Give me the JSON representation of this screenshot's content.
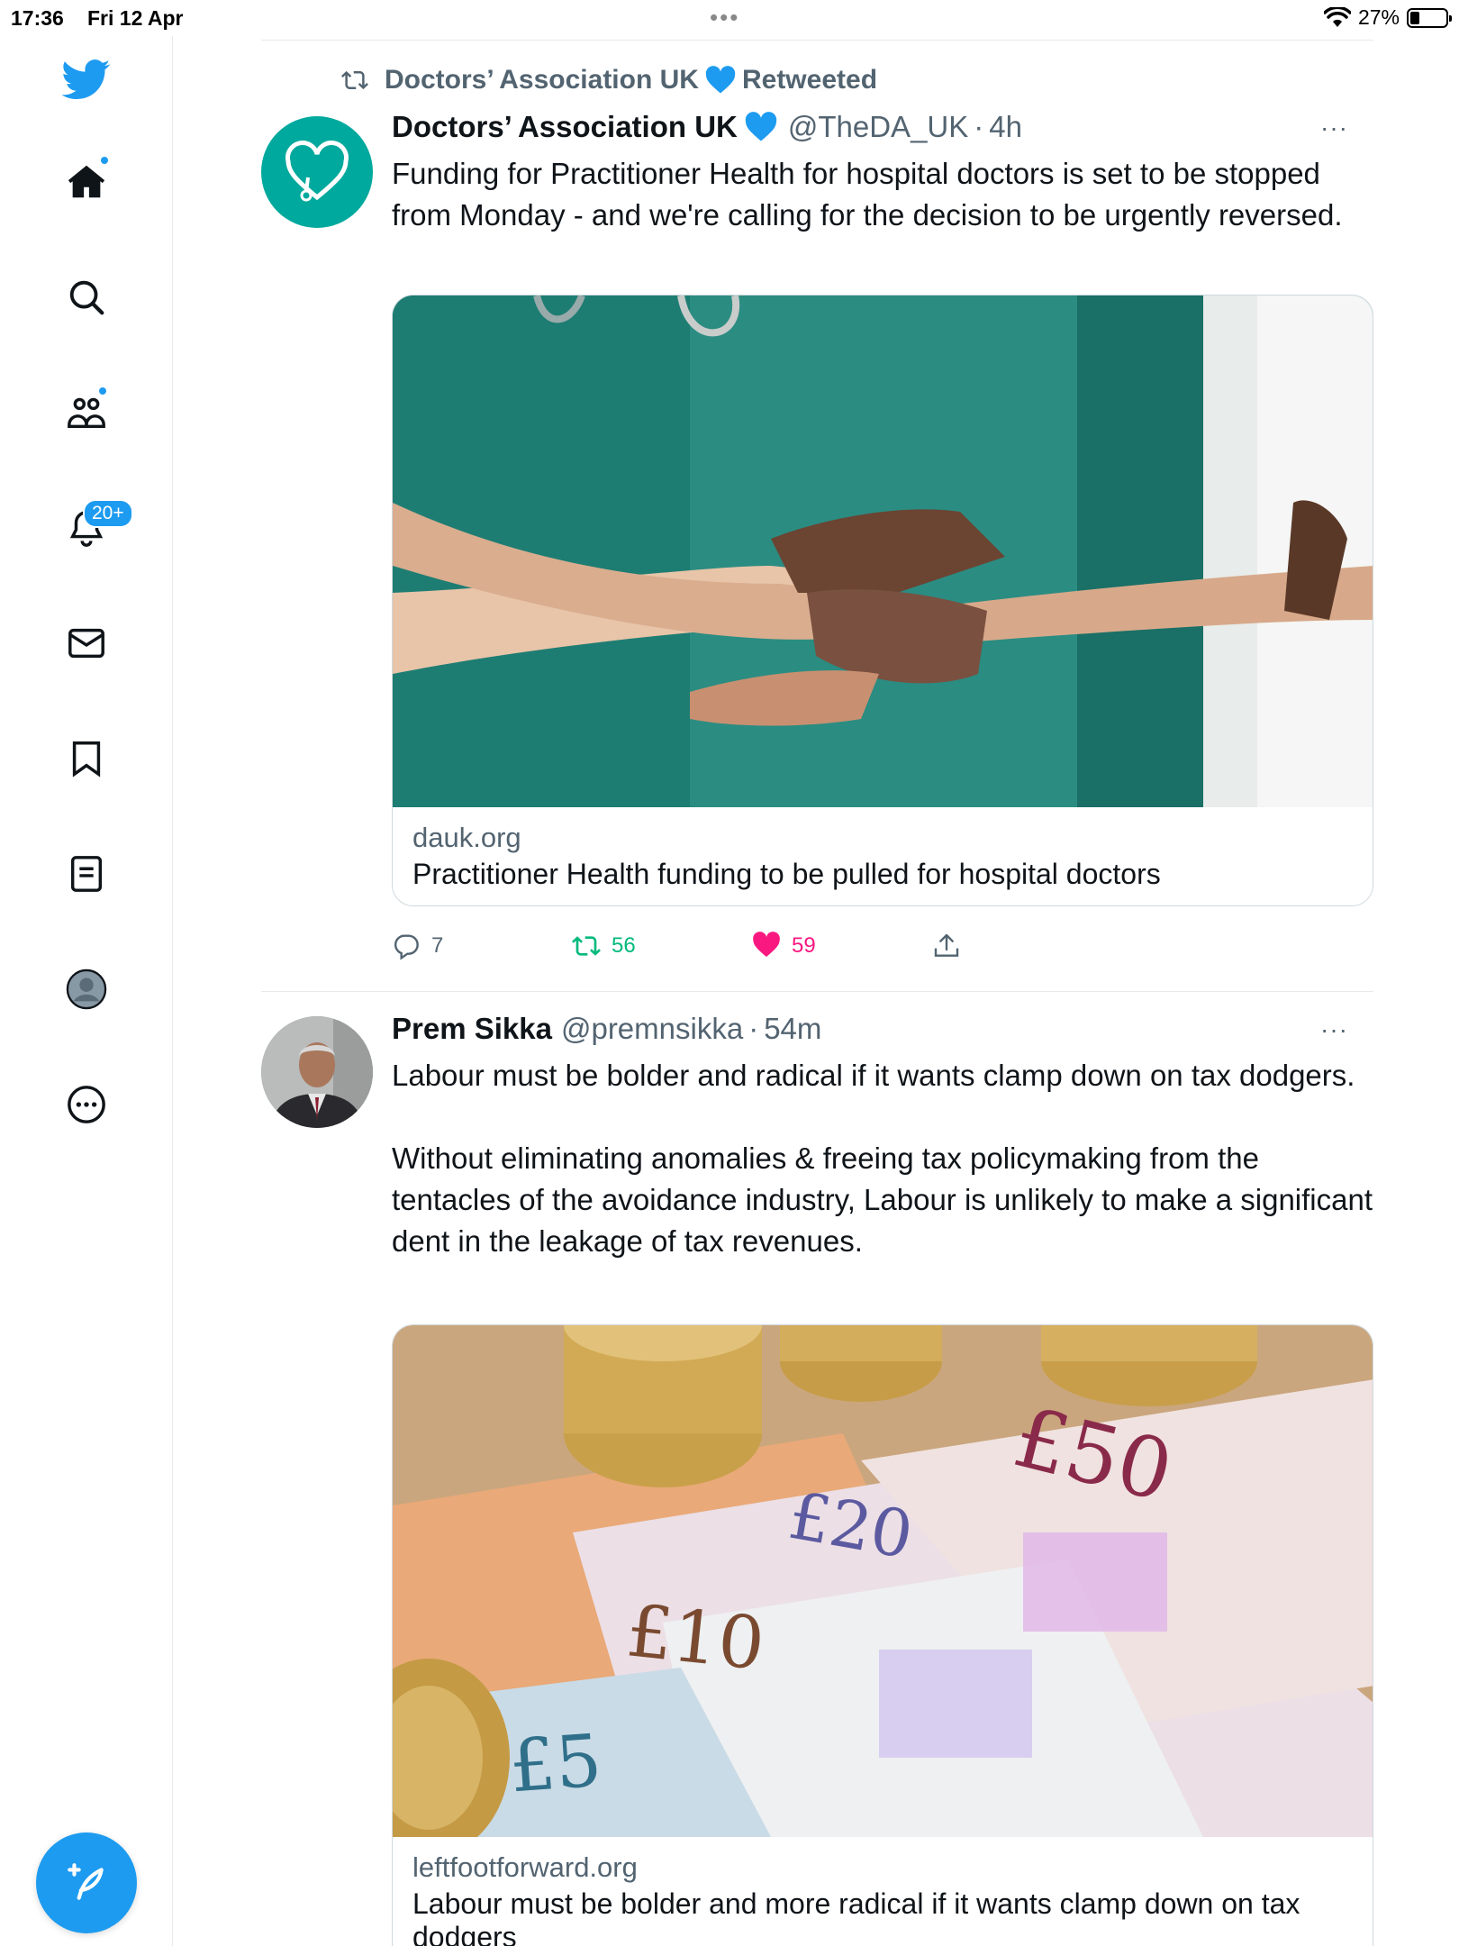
{
  "status_bar": {
    "time": "17:36",
    "date": "Fri 12 Apr",
    "battery": "27%",
    "battery_level": 0.27
  },
  "sidebar": {
    "notifications_badge": "20+",
    "items": [
      "twitter-logo",
      "home-icon",
      "search-icon",
      "communities-icon",
      "notifications-icon",
      "messages-icon",
      "bookmarks-icon",
      "lists-icon",
      "profile-icon",
      "more-icon"
    ]
  },
  "tweets": [
    {
      "retweeted_by": "Doctors’ Association UK",
      "retweet_label": "Retweeted",
      "name": "Doctors’ Association UK",
      "handle": "@TheDA_UK",
      "separator": "·",
      "time": "4h",
      "more": "···",
      "text": "Funding for Practitioner Health for hospital doctors is set to be stopped from Monday - and we're calling for the decision to be urgently reversed.",
      "card": {
        "domain": "dauk.org",
        "title": "Practitioner Health funding to be pulled for hospital doctors"
      },
      "replies": "7",
      "retweets": "56",
      "likes": "59",
      "accent": "#00a99d"
    },
    {
      "name": "Prem Sikka",
      "handle": "@premnsikka",
      "separator": "·",
      "time": "54m",
      "more": "···",
      "text": "Labour must be bolder and radical if it wants clamp down on tax dodgers.\n\nWithout eliminating anomalies & freeing tax policymaking from the tentacles of the avoidance industry, Labour is unlikely to make a significant dent in the leakage of tax revenues.",
      "card": {
        "domain": "leftfootforward.org",
        "title": "Labour must be bolder and more radical if it wants clamp down on tax dodgers"
      },
      "notes": [
        "£50",
        "£20",
        "£10",
        "£5"
      ]
    }
  ],
  "colors": {
    "brand": "#1d9bf0",
    "retweet": "#00ba7c",
    "like": "#f91880",
    "text_secondary": "#536471"
  }
}
